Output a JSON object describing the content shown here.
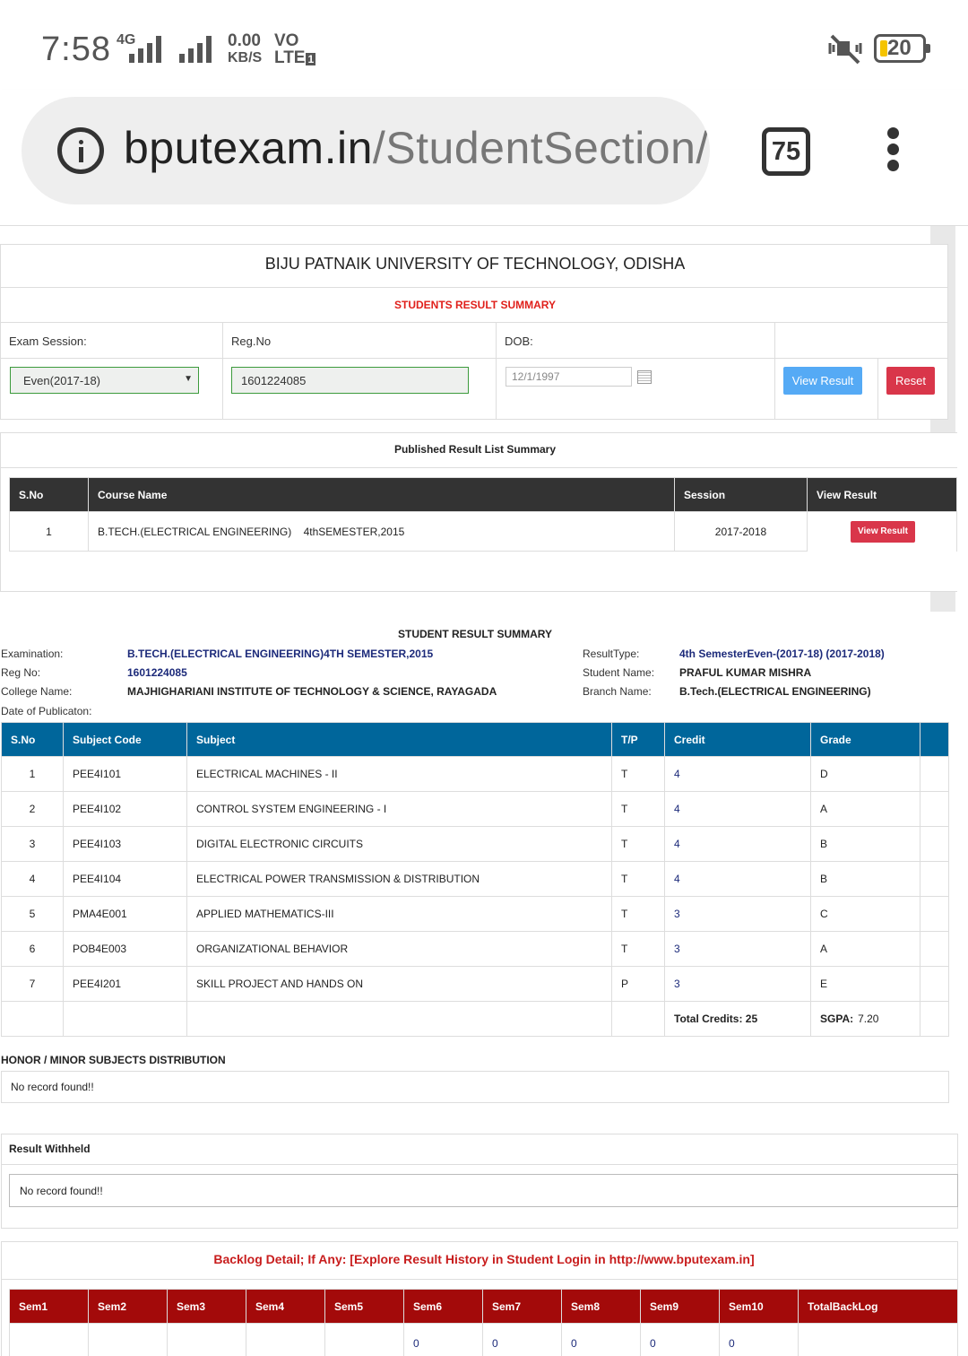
{
  "status_bar": {
    "time": "7:58",
    "network": "4G",
    "speed_value": "0.00",
    "speed_unit": "KB/S",
    "volte_top": "VO",
    "volte_bottom": "LTE",
    "sim": "1",
    "battery": "20",
    "icons": [
      "signal-icon",
      "mute-icon",
      "battery-icon"
    ]
  },
  "browser": {
    "url_host": "bputexam.in",
    "url_path": "/StudentSection/",
    "tab_count": "75"
  },
  "header": {
    "university": "BIJU PATNAIK UNIVERSITY OF TECHNOLOGY, ODISHA",
    "subtitle": "STUDENTS RESULT SUMMARY"
  },
  "form": {
    "exam_session_label": "Exam Session:",
    "regno_label": "Reg.No",
    "dob_label": "DOB:",
    "exam_session_value": "Even(2017-18)",
    "regno_value": "1601224085",
    "dob_value": "12/1/1997",
    "view_button": "View Result",
    "reset_button": "Reset"
  },
  "published": {
    "title": "Published Result  List Summary",
    "columns": [
      "S.No",
      "Course Name",
      "Session",
      "View Result"
    ],
    "rows": [
      {
        "sno": "1",
        "course": "B.TECH.(ELECTRICAL ENGINEERING)    4thSEMESTER,2015",
        "session": "2017-2018",
        "button": "View Result"
      }
    ]
  },
  "summary": {
    "title": "STUDENT RESULT SUMMARY",
    "examination_label": "Examination:",
    "examination": "B.TECH.(ELECTRICAL ENGINEERING)4TH SEMESTER,2015",
    "regno_label": "Reg No:",
    "regno": "1601224085",
    "college_label": "College Name:",
    "college": "MAJHIGHARIANI INSTITUTE OF TECHNOLOGY & SCIENCE, RAYAGADA",
    "pub_label": "Date of Publicaton:",
    "resulttype_label": "ResultType:",
    "resulttype": "4th SemesterEven-(2017-18) (2017-2018)",
    "student_label": "Student Name:",
    "student": "PRAFUL KUMAR MISHRA",
    "branch_label": "Branch Name:",
    "branch": "B.Tech.(ELECTRICAL ENGINEERING)"
  },
  "grades": {
    "columns": [
      "S.No",
      "Subject Code",
      "Subject",
      "T/P",
      "Credit",
      "Grade"
    ],
    "rows": [
      {
        "sno": "1",
        "code": "PEE4I101",
        "subject": "ELECTRICAL MACHINES - II",
        "tp": "T",
        "credit": "4",
        "grade": "D"
      },
      {
        "sno": "2",
        "code": "PEE4I102",
        "subject": "CONTROL SYSTEM ENGINEERING - I",
        "tp": "T",
        "credit": "4",
        "grade": "A"
      },
      {
        "sno": "3",
        "code": "PEE4I103",
        "subject": "DIGITAL ELECTRONIC CIRCUITS",
        "tp": "T",
        "credit": "4",
        "grade": "B"
      },
      {
        "sno": "4",
        "code": "PEE4I104",
        "subject": "ELECTRICAL POWER TRANSMISSION & DISTRIBUTION",
        "tp": "T",
        "credit": "4",
        "grade": "B"
      },
      {
        "sno": "5",
        "code": "PMA4E001",
        "subject": "APPLIED MATHEMATICS-III",
        "tp": "T",
        "credit": "3",
        "grade": "C"
      },
      {
        "sno": "6",
        "code": "POB4E003",
        "subject": "ORGANIZATIONAL BEHAVIOR",
        "tp": "T",
        "credit": "3",
        "grade": "A"
      },
      {
        "sno": "7",
        "code": "PEE4I201",
        "subject": "SKILL PROJECT AND HANDS ON",
        "tp": "P",
        "credit": "3",
        "grade": "E"
      }
    ],
    "total_credits": "Total Credits: 25",
    "sgpa_label": "SGPA:",
    "sgpa": "7.20"
  },
  "honor": {
    "title": "HONOR / MINOR SUBJECTS DISTRIBUTION",
    "message": "No record found!!"
  },
  "withheld": {
    "title": "Result Withheld",
    "message": "No record found!!"
  },
  "backlog": {
    "title": "Backlog Detail; If Any: [Explore Result History in Student Login in http://www.bputexam.in]",
    "columns": [
      "Sem1",
      "Sem2",
      "Sem3",
      "Sem4",
      "Sem5",
      "Sem6",
      "Sem7",
      "Sem8",
      "Sem9",
      "Sem10",
      "TotalBackLog"
    ],
    "values": [
      "",
      "",
      "",
      "",
      "",
      "0",
      "0",
      "0",
      "0",
      "0",
      ""
    ]
  },
  "colors": {
    "accent_blue": "#00669b",
    "dark_header": "#333333",
    "backlog_red": "#a30a0a",
    "title_red": "#e0201b",
    "button_blue": "#55aaf5",
    "button_red": "#d9364a"
  }
}
